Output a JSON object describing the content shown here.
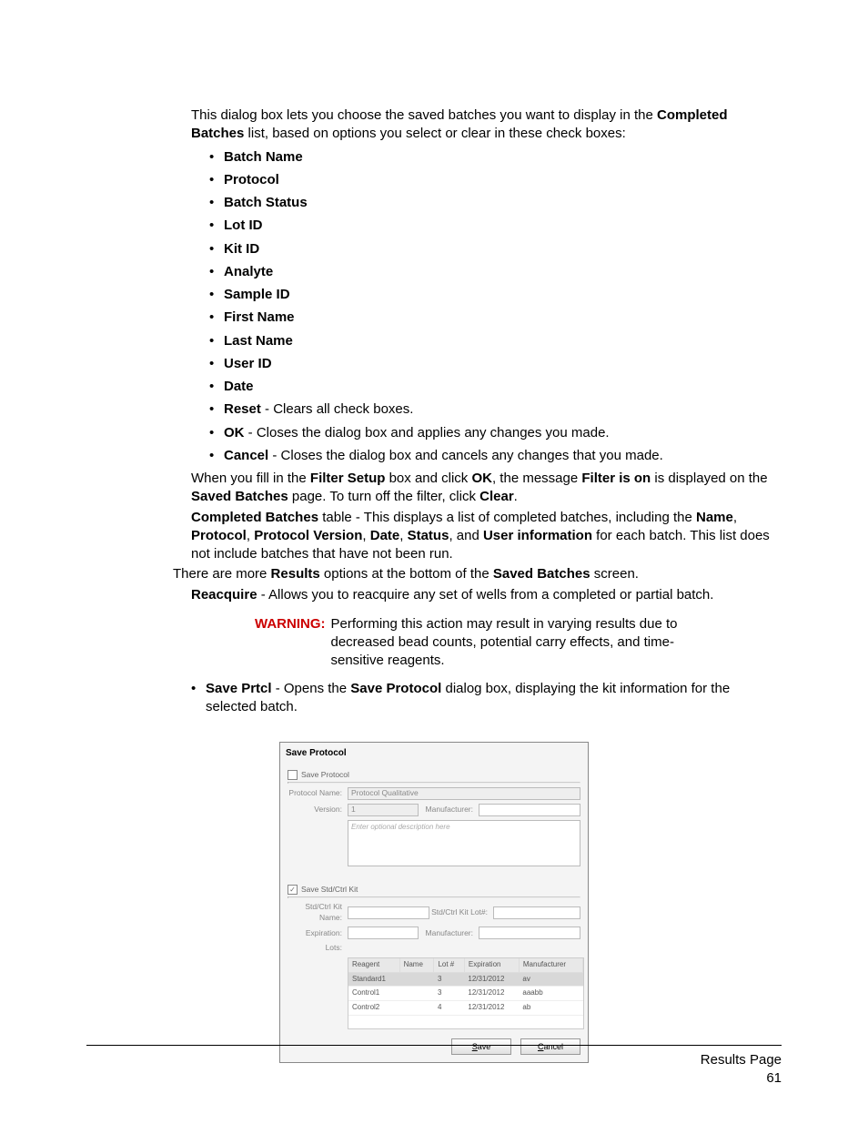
{
  "intro": {
    "pre": "This dialog box lets you choose the saved batches you want to display in the ",
    "b1": "Completed Batches",
    "post": " list, based on options you select or clear in these check boxes:"
  },
  "checkboxes": [
    "Batch Name",
    "Protocol",
    "Batch Status",
    "Lot ID",
    "Kit ID",
    "Analyte",
    "Sample ID",
    "First Name",
    "Last Name",
    "User ID",
    "Date"
  ],
  "actions": {
    "reset_b": "Reset",
    "reset_t": " - Clears all check boxes.",
    "ok_b": "OK",
    "ok_t": " - Closes the dialog box and applies any changes you made.",
    "cancel_b": "Cancel",
    "cancel_t": " - Closes the dialog box and cancels any changes that you made."
  },
  "filter": {
    "t1": "When you fill in the ",
    "b1": "Filter Setup",
    "t2": " box and click ",
    "b2": "OK",
    "t3": ", the message ",
    "b3": "Filter is on",
    "t4": " is displayed on the ",
    "b4": "Saved Batches",
    "t5": " page. To turn off the filter, click ",
    "b5": "Clear",
    "t6": "."
  },
  "completed": {
    "b1": "Completed Batches",
    "t1": " table - This displays a list of completed batches, including the ",
    "b2": "Name",
    "c1": ", ",
    "b3": "Protocol",
    "c2": ", ",
    "b4": "Protocol Version",
    "c3": ", ",
    "b5": "Date",
    "c4": ", ",
    "b6": "Status",
    "c5": ", and ",
    "b7": "User information",
    "t2": " for each batch. This list does not include batches that have not been run."
  },
  "more": {
    "t1": "There are more ",
    "b1": "Results",
    "t2": " options at the bottom of the ",
    "b2": "Saved Batches",
    "t3": " screen."
  },
  "reacquire": {
    "b": "Reacquire",
    "t": " - Allows you to reacquire any set of wells from a completed or partial batch."
  },
  "warning": {
    "label": "WARNING:",
    "text": "Performing this action may result in varying results due to decreased bead counts, potential carry effects, and time-sensitive reagents."
  },
  "save_prtcl": {
    "b1": "Save Prtcl",
    "t1": " - Opens the ",
    "b2": "Save Protocol",
    "t2": " dialog box, displaying the kit information for the selected batch."
  },
  "dialog": {
    "title": "Save Protocol",
    "cb1_label": "Save Protocol",
    "cb2_label": "Save Std/Ctrl Kit",
    "labels": {
      "protocol_name": "Protocol Name:",
      "version": "Version:",
      "manufacturer": "Manufacturer:",
      "kit_name": "Std/Ctrl Kit Name:",
      "kit_lot": "Std/Ctrl Kit Lot#:",
      "expiration": "Expiration:",
      "lots": "Lots:"
    },
    "values": {
      "protocol_name": "Protocol Qualitative",
      "version": "1",
      "desc_placeholder": "Enter optional description here"
    },
    "table": {
      "headers": [
        "Reagent",
        "Name",
        "Lot #",
        "Expiration",
        "Manufacturer"
      ],
      "rows": [
        {
          "sel": true,
          "c": [
            "Standard1",
            "",
            "3",
            "12/31/2012",
            "av"
          ]
        },
        {
          "sel": false,
          "c": [
            "Control1",
            "",
            "3",
            "12/31/2012",
            "aaabb"
          ]
        },
        {
          "sel": false,
          "c": [
            "Control2",
            "",
            "4",
            "12/31/2012",
            "ab"
          ]
        }
      ]
    },
    "buttons": {
      "save": "ave",
      "save_mn": "S",
      "cancel": "ancel",
      "cancel_mn": "C"
    }
  },
  "footer": {
    "title": "Results Page",
    "num": "61"
  }
}
